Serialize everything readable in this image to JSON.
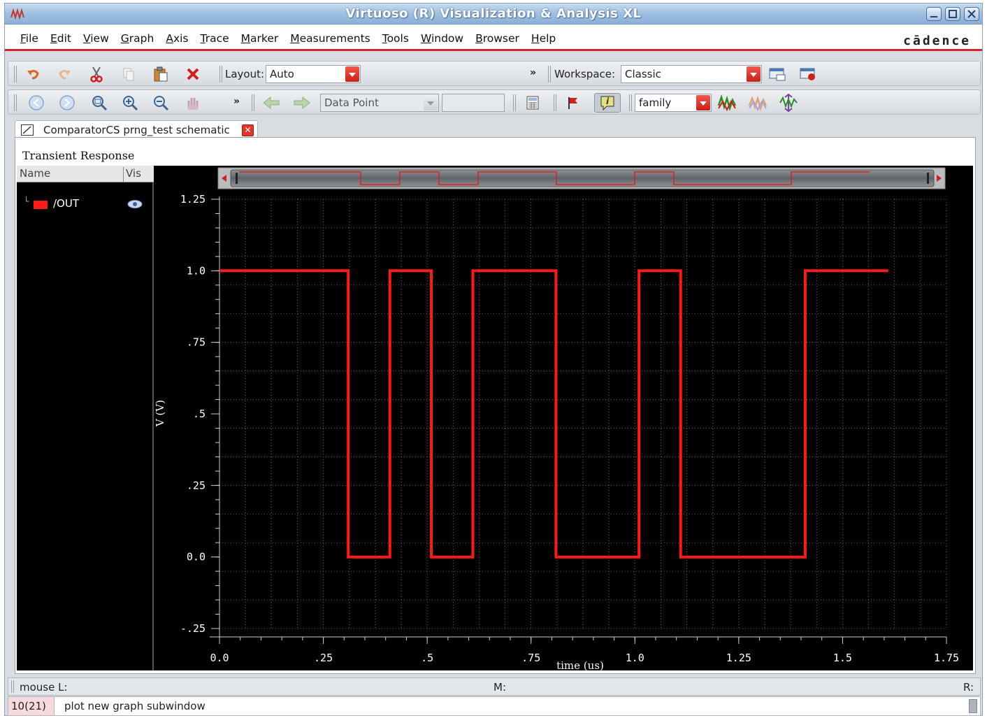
{
  "window": {
    "title": "Virtuoso (R) Visualization & Analysis XL"
  },
  "menubar": {
    "items": [
      "File",
      "Edit",
      "View",
      "Graph",
      "Axis",
      "Trace",
      "Marker",
      "Measurements",
      "Tools",
      "Window",
      "Browser",
      "Help"
    ],
    "brand": "cādence"
  },
  "toolbar1": {
    "icons": [
      "undo-icon",
      "redo-icon",
      "cut-icon",
      "copy-icon",
      "paste-icon",
      "delete-icon"
    ],
    "layout_label": "Layout:",
    "layout_value": "Auto",
    "more": "»",
    "workspace_label": "Workspace:",
    "workspace_value": "Classic"
  },
  "toolbar2": {
    "more": "»",
    "datapoint_value": "Data Point",
    "family_value": "family"
  },
  "tab": {
    "label": "ComparatorCS prng_test schematic"
  },
  "graph": {
    "title": "Transient Response",
    "legend_header_name": "Name",
    "legend_header_vis": "Vis",
    "signal_name": "/OUT",
    "signal_color": "#ff1a1a"
  },
  "chart_data": {
    "type": "line",
    "title": "Transient Response",
    "xlabel": "time (us)",
    "ylabel": "V (V)",
    "xlim": [
      0.0,
      1.75
    ],
    "ylim": [
      -0.25,
      1.25
    ],
    "x_ticks": [
      "0.0",
      ".25",
      ".5",
      ".75",
      "1.0",
      "1.25",
      "1.5",
      "1.75"
    ],
    "y_ticks": [
      "-.25",
      "0.0",
      ".25",
      ".5",
      ".75",
      "1.0",
      "1.25"
    ],
    "grid": true,
    "series": [
      {
        "name": "/OUT",
        "color": "#ff1a1a",
        "x": [
          0.0,
          0.31,
          0.31,
          0.41,
          0.41,
          0.51,
          0.51,
          0.61,
          0.61,
          0.81,
          0.81,
          1.01,
          1.01,
          1.11,
          1.11,
          1.41,
          1.41,
          1.61
        ],
        "y": [
          1.0,
          1.0,
          0.0,
          0.0,
          1.0,
          1.0,
          0.0,
          0.0,
          1.0,
          1.0,
          0.0,
          0.0,
          1.0,
          1.0,
          0.0,
          0.0,
          1.0,
          1.0
        ]
      }
    ]
  },
  "statusbar": {
    "mouse_l": "mouse L:",
    "mouse_m": "M:",
    "mouse_r": "R:"
  },
  "cmdbar": {
    "count": "10(21)",
    "message": "plot new graph subwindow"
  }
}
